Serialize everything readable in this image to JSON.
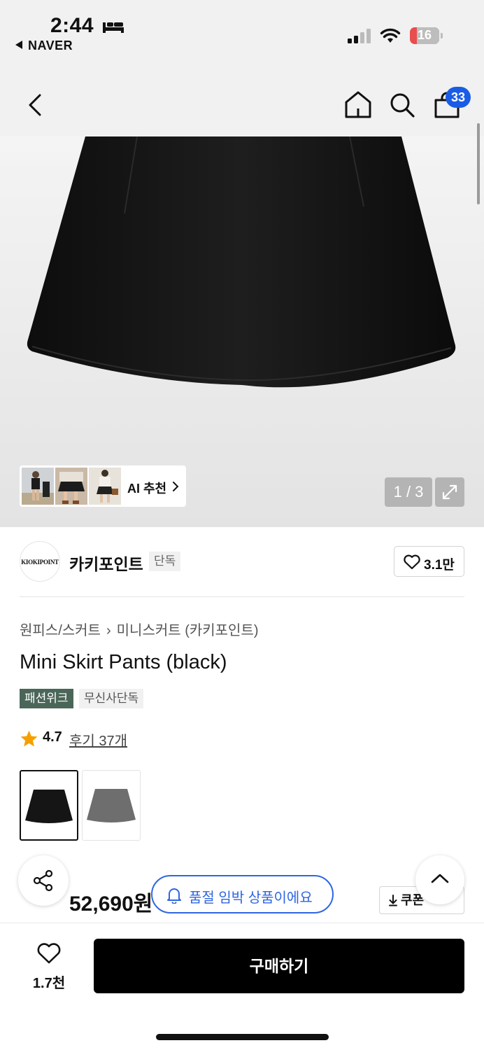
{
  "status_bar": {
    "time": "2:44",
    "back_app": "NAVER",
    "battery": "16",
    "battery_color": "#e94e4e"
  },
  "header": {
    "icons": [
      "back-icon",
      "home-icon",
      "search-icon",
      "cart-icon"
    ],
    "cart_count": "33"
  },
  "gallery": {
    "ai_recommend_label": "AI 추천",
    "page_indicator": "1 / 3"
  },
  "brand": {
    "logo_text": "KIOKIPOINT",
    "name": "카키포인트",
    "tag": "단독",
    "likes": "3.1만"
  },
  "product": {
    "breadcrumb": [
      "원피스/스커트",
      "미니스커트 (카키포인트)"
    ],
    "title": "Mini Skirt Pants (black)",
    "tags": [
      "패션위크",
      "무신사단독"
    ],
    "tag_color": "#4a6658",
    "rating": "4.7",
    "reviews": "후기 37개",
    "color_options": [
      "black",
      "gray"
    ]
  },
  "price": {
    "original_visible": "원",
    "discount_visible": "%",
    "current": "52,690원",
    "discount_color": "#e8202a",
    "coupon_label": "쿠폰"
  },
  "toast": {
    "message": "품절 임박 상품이에요",
    "color": "#2f66e0"
  },
  "bottom_bar": {
    "wish_count": "1.7천",
    "buy_label": "구매하기"
  }
}
